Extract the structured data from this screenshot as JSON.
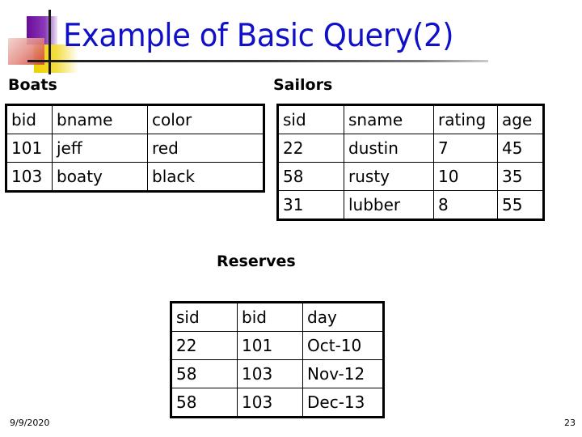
{
  "slide": {
    "title": "Example of Basic Query(2)",
    "date": "9/9/2020",
    "page_number": "23"
  },
  "boats": {
    "caption": "Boats",
    "headers": [
      "bid",
      "bname",
      "color"
    ],
    "rows": [
      [
        "101",
        "jeff",
        "red"
      ],
      [
        "103",
        "boaty",
        "black"
      ]
    ]
  },
  "sailors": {
    "caption": "Sailors",
    "headers": [
      "sid",
      "sname",
      "rating",
      "age"
    ],
    "rows": [
      [
        "22",
        "dustin",
        "7",
        "45"
      ],
      [
        "58",
        "rusty",
        "10",
        "35"
      ],
      [
        "31",
        "lubber",
        "8",
        "55"
      ]
    ]
  },
  "reserves": {
    "caption": "Reserves",
    "headers": [
      "sid",
      "bid",
      "day"
    ],
    "rows": [
      [
        "22",
        "101",
        "Oct-10"
      ],
      [
        "58",
        "103",
        "Nov-12"
      ],
      [
        "58",
        "103",
        "Dec-13"
      ]
    ]
  }
}
